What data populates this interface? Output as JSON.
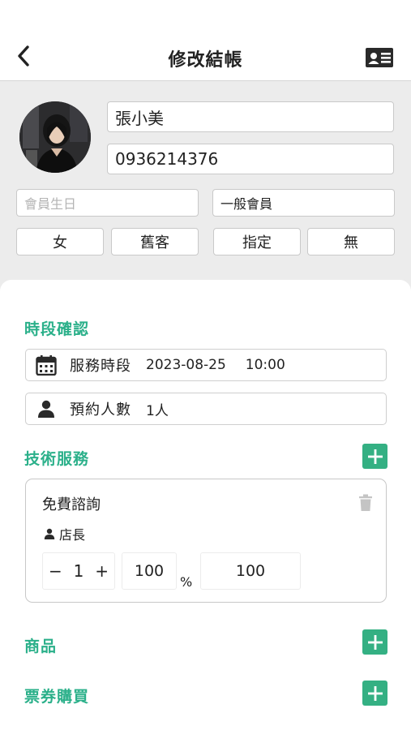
{
  "header": {
    "title": "修改結帳",
    "back_icon": "chevron-left-icon",
    "card_icon": "id-card-icon"
  },
  "profile": {
    "name": "張小美",
    "phone": "0936214376",
    "birthday_placeholder": "會員生日",
    "member_level": "一般會員",
    "tags": [
      "女",
      "舊客",
      "指定",
      "無"
    ]
  },
  "timeslot": {
    "title": "時段確認",
    "service_time_label": "服務時段",
    "date": "2023-08-25",
    "time": "10:00",
    "people_label": "預約人數",
    "people_value": "1人"
  },
  "services": {
    "title": "技術服務",
    "items": [
      {
        "name": "免費諮詢",
        "staff": "店長",
        "quantity": "1",
        "discount": "100",
        "discount_unit": "%",
        "price": "100"
      }
    ]
  },
  "products": {
    "title": "商品"
  },
  "tickets": {
    "title": "票券購買"
  },
  "colors": {
    "accent": "#2bb08a",
    "plus_button": "#34b083",
    "profile_bg": "#ececec"
  }
}
